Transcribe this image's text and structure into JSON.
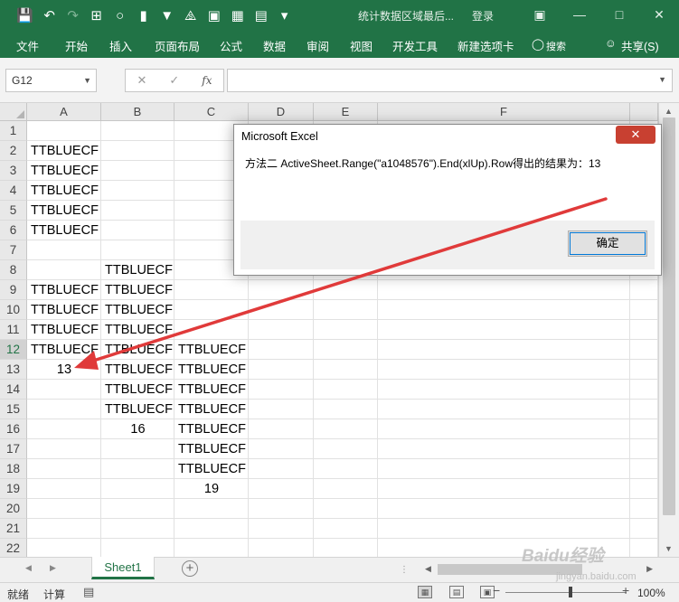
{
  "window": {
    "title": "统计数据区域最后...",
    "login": "登录",
    "accent": "#217346"
  },
  "ribbon_tabs": [
    "文件",
    "开始",
    "插入",
    "页面布局",
    "公式",
    "数据",
    "审阅",
    "视图",
    "开发工具",
    "新建选项卡",
    "搜索",
    "共享(S)"
  ],
  "formula_bar": {
    "name_box": "G12",
    "formula": ""
  },
  "columns": [
    "A",
    "B",
    "C",
    "D",
    "E",
    "F"
  ],
  "rows": [
    "1",
    "2",
    "3",
    "4",
    "5",
    "6",
    "7",
    "8",
    "9",
    "10",
    "11",
    "12",
    "13",
    "14",
    "15",
    "16",
    "17",
    "18",
    "19",
    "20",
    "21",
    "22"
  ],
  "cells": {
    "A2": "TTBLUECF",
    "A3": "TTBLUECF",
    "A4": "TTBLUECF",
    "A5": "TTBLUECF",
    "A6": "TTBLUECF",
    "A9": "TTBLUECF",
    "A10": "TTBLUECF",
    "A11": "TTBLUECF",
    "A12": "TTBLUECF",
    "A13": "13",
    "B8": "TTBLUECF",
    "B9": "TTBLUECF",
    "B10": "TTBLUECF",
    "B11": "TTBLUECF",
    "B12": "TTBLUECF",
    "B13": "TTBLUECF",
    "B14": "TTBLUECF",
    "B15": "TTBLUECF",
    "B16": "16",
    "C12": "TTBLUECF",
    "C13": "TTBLUECF",
    "C14": "TTBLUECF",
    "C15": "TTBLUECF",
    "C16": "TTBLUECF",
    "C17": "TTBLUECF",
    "C18": "TTBLUECF",
    "C19": "19"
  },
  "dialog": {
    "title": "Microsoft Excel",
    "message": "方法二  ActiveSheet.Range(\"a1048576\").End(xlUp).Row得出的结果为：13",
    "ok_label": "确定"
  },
  "sheet_tabs": {
    "active": "Sheet1"
  },
  "status_bar": {
    "ready": "就绪",
    "calc": "计算",
    "zoom": "100%"
  },
  "watermark": {
    "text": "Baidu经验",
    "sub": "jingyan.baidu.com"
  },
  "arrow_color": "#e03a3a"
}
